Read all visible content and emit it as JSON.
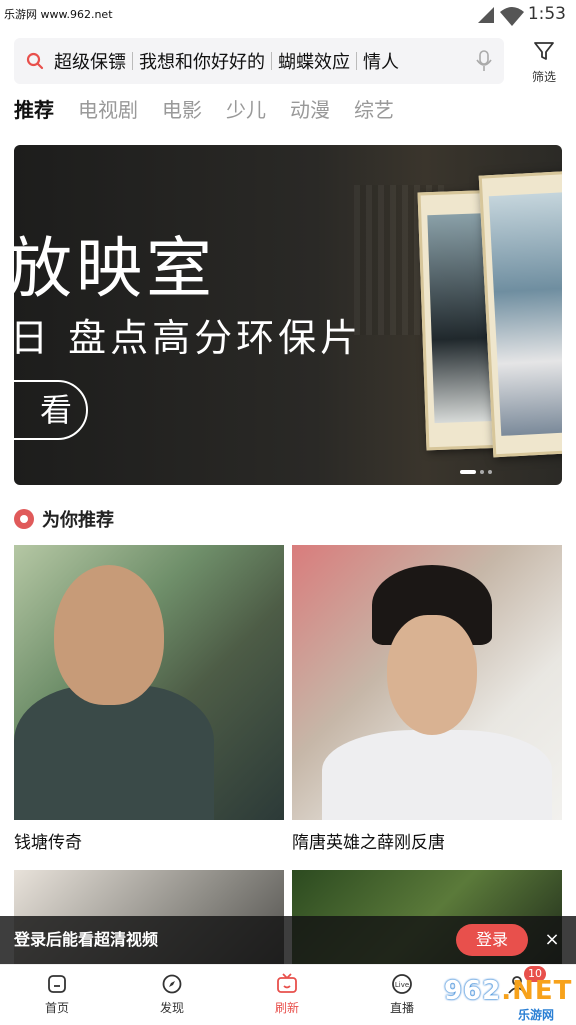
{
  "status_bar": {
    "watermark": "乐游网 www.962.net",
    "time": "1:53"
  },
  "search": {
    "terms": [
      "超级保镖",
      "我想和你好好的",
      "蝴蝶效应",
      "情人"
    ],
    "filter_label": "筛选"
  },
  "tabs": [
    {
      "label": "推荐",
      "active": true
    },
    {
      "label": "电视剧"
    },
    {
      "label": "电影"
    },
    {
      "label": "少儿"
    },
    {
      "label": "动漫"
    },
    {
      "label": "综艺"
    }
  ],
  "banner": {
    "title": "放映室",
    "subtitle": "日 盘点高分环保片",
    "button": "看",
    "slides_total": 3,
    "slide_active": 1
  },
  "section": {
    "title": "为你推荐"
  },
  "posters": [
    {
      "title": "钱塘传奇"
    },
    {
      "title": "隋唐英雄之薛刚反唐"
    },
    {
      "title": ""
    },
    {
      "title": ""
    }
  ],
  "login_banner": {
    "text": "登录后能看超清视频",
    "button": "登录",
    "close": "×"
  },
  "nav": [
    {
      "label": "首页",
      "icon": "home-icon"
    },
    {
      "label": "发现",
      "icon": "compass-icon"
    },
    {
      "label": "刷新",
      "icon": "tv-icon",
      "active": true
    },
    {
      "label": "直播",
      "icon": "live-icon"
    },
    {
      "label": "",
      "icon": "profile-icon"
    }
  ],
  "nav_badge": "10",
  "watermark_logo": {
    "big_a": "962",
    "big_b": ".NET",
    "small": "乐游网"
  },
  "colors": {
    "accent": "#e8504c",
    "watermark_orange": "#f7a21b",
    "watermark_blue": "#2a7fd4"
  }
}
